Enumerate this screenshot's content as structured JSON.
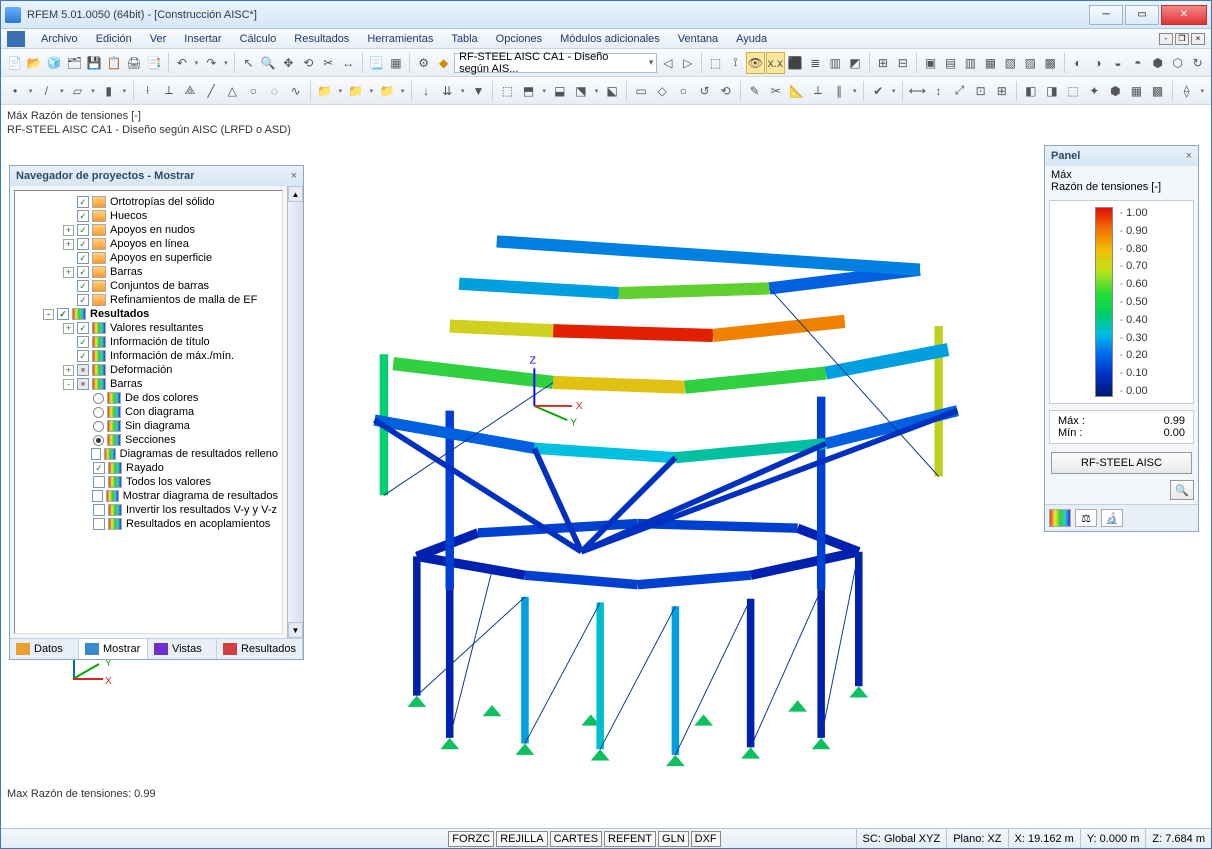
{
  "window": {
    "title": "RFEM 5.01.0050 (64bit) - [Construcción AISC*]"
  },
  "menu": [
    "Archivo",
    "Edición",
    "Ver",
    "Insertar",
    "Cálculo",
    "Resultados",
    "Herramientas",
    "Tabla",
    "Opciones",
    "Módulos adicionales",
    "Ventana",
    "Ayuda"
  ],
  "toolbar": {
    "combo": "RF-STEEL AISC CA1 - Diseño según AIS..."
  },
  "viewport": {
    "line1": "Máx Razón de tensiones [-]",
    "line2": "RF-STEEL AISC CA1 - Diseño según AISC (LRFD o ASD)",
    "bottom": "Max Razón de tensiones: 0.99"
  },
  "navigator": {
    "title": "Navegador de proyectos - Mostrar",
    "items": [
      {
        "lvl": 2,
        "exp": "",
        "chk": "checked",
        "icon": "pen",
        "label": "Ortotropías del sólido"
      },
      {
        "lvl": 2,
        "exp": "",
        "chk": "checked",
        "icon": "pen",
        "label": "Huecos"
      },
      {
        "lvl": 2,
        "exp": "+",
        "chk": "checked",
        "icon": "pen",
        "label": "Apoyos en nudos"
      },
      {
        "lvl": 2,
        "exp": "+",
        "chk": "checked",
        "icon": "pen",
        "label": "Apoyos en línea"
      },
      {
        "lvl": 2,
        "exp": "",
        "chk": "checked",
        "icon": "pen",
        "label": "Apoyos en superficie"
      },
      {
        "lvl": 2,
        "exp": "+",
        "chk": "checked",
        "icon": "pen",
        "label": "Barras"
      },
      {
        "lvl": 2,
        "exp": "",
        "chk": "checked",
        "icon": "pen",
        "label": "Conjuntos de barras"
      },
      {
        "lvl": 2,
        "exp": "",
        "chk": "checked",
        "icon": "pen",
        "label": "Refinamientos de malla de EF"
      },
      {
        "lvl": 1,
        "exp": "-",
        "chk": "checked",
        "icon": "res",
        "label": "Resultados",
        "bold": true
      },
      {
        "lvl": 2,
        "exp": "+",
        "chk": "checked",
        "icon": "res",
        "label": "Valores resultantes"
      },
      {
        "lvl": 2,
        "exp": "",
        "chk": "checked",
        "icon": "res",
        "label": "Información de título"
      },
      {
        "lvl": 2,
        "exp": "",
        "chk": "checked",
        "icon": "res",
        "label": "Información de máx./mín."
      },
      {
        "lvl": 2,
        "exp": "+",
        "chk": "mixed",
        "icon": "res",
        "label": "Deformación"
      },
      {
        "lvl": 2,
        "exp": "-",
        "chk": "mixed",
        "icon": "res",
        "label": "Barras"
      },
      {
        "lvl": 3,
        "exp": "",
        "radio": false,
        "icon": "res",
        "label": "De dos colores"
      },
      {
        "lvl": 3,
        "exp": "",
        "radio": false,
        "icon": "res",
        "label": "Con diagrama"
      },
      {
        "lvl": 3,
        "exp": "",
        "radio": false,
        "icon": "res",
        "label": "Sin diagrama"
      },
      {
        "lvl": 3,
        "exp": "",
        "radio": true,
        "icon": "res",
        "label": "Secciones"
      },
      {
        "lvl": 3,
        "exp": "",
        "chk": "",
        "icon": "res",
        "label": "Diagramas de resultados relleno"
      },
      {
        "lvl": 3,
        "exp": "",
        "chk": "checked",
        "icon": "res",
        "label": "Rayado"
      },
      {
        "lvl": 3,
        "exp": "",
        "chk": "",
        "icon": "res",
        "label": "Todos los valores"
      },
      {
        "lvl": 3,
        "exp": "",
        "chk": "",
        "icon": "res",
        "label": "Mostrar diagrama de resultados"
      },
      {
        "lvl": 3,
        "exp": "",
        "chk": "",
        "icon": "res",
        "label": "Invertir los resultados V-y y V-z"
      },
      {
        "lvl": 3,
        "exp": "",
        "chk": "",
        "icon": "res",
        "label": "Resultados en acoplamientos"
      }
    ],
    "tabs": [
      "Datos",
      "Mostrar",
      "Vistas",
      "Resultados"
    ],
    "activeTab": 1
  },
  "panel": {
    "title": "Panel",
    "sub1": "Máx",
    "sub2": "Razón de tensiones [-]",
    "ticks": [
      "1.00",
      "0.90",
      "0.80",
      "0.70",
      "0.60",
      "0.50",
      "0.40",
      "0.30",
      "0.20",
      "0.10",
      "0.00"
    ],
    "max_label": "Máx  :",
    "max_val": "0.99",
    "min_label": "Mín   :",
    "min_val": "0.00",
    "button": "RF-STEEL AISC"
  },
  "status": {
    "toggles": [
      "FORZC",
      "REJILLA",
      "CARTES",
      "REFENT",
      "GLN",
      "DXF"
    ],
    "sc": "SC: Global XYZ",
    "plane": "Plano: XZ",
    "x": "X:  19.162 m",
    "y": "Y:  0.000 m",
    "z": "Z:  7.684 m"
  },
  "axes": {
    "x": "X",
    "y": "Y",
    "z": "Z"
  }
}
